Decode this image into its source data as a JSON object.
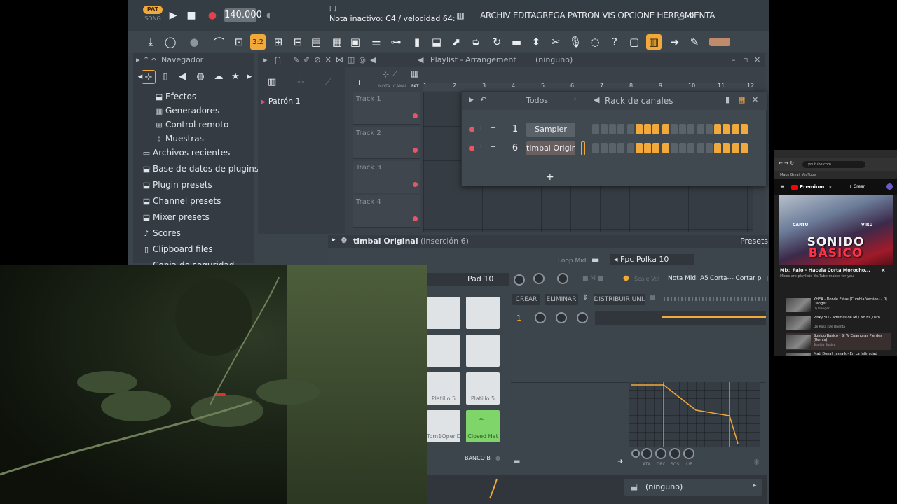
{
  "fl": {
    "pat_label": "PAT",
    "song_label": "SONG",
    "tempo": "140.000",
    "hint_top": "[ ]",
    "hint": "Nota inactivo: C4 / velocidad 64:",
    "menu": "ARCHIV EDITAGREGA PATRON  VIS OPCIONE HERRAMIENTA",
    "playlist_title": "Playlist - Arrangement",
    "playlist_pattern": "(ninguno)",
    "pattern_name": "Patrón 1",
    "ruler": [
      "1",
      "2",
      "3",
      "4",
      "5",
      "6",
      "7",
      "8",
      "9",
      "10",
      "11",
      "12"
    ],
    "tracks": [
      "Track 1",
      "Track 2",
      "Track 3",
      "Track 4"
    ],
    "head_labels": [
      "NOTA",
      "CANAL",
      "PAT"
    ]
  },
  "browser": {
    "title": "Navegador",
    "items": [
      {
        "icon": "plugin-icon",
        "label": "Efectos",
        "sub": true
      },
      {
        "icon": "piano-icon",
        "label": "Generadores",
        "sub": true
      },
      {
        "icon": "remote-icon",
        "label": "Control remoto",
        "sub": true
      },
      {
        "icon": "wave-icon",
        "label": "Muestras",
        "sub": true
      },
      {
        "icon": "folder-icon",
        "label": "Archivos recientes",
        "sub": false
      },
      {
        "icon": "plugin-db-icon",
        "label": "Base de datos de plugins",
        "sub": false
      },
      {
        "icon": "plugin-preset-icon",
        "label": "Plugin presets",
        "sub": false
      },
      {
        "icon": "channel-preset-icon",
        "label": "Channel presets",
        "sub": false
      },
      {
        "icon": "mixer-preset-icon",
        "label": "Mixer presets",
        "sub": false
      },
      {
        "icon": "note-icon",
        "label": "Scores",
        "sub": false
      },
      {
        "icon": "clipboard-icon",
        "label": "Clipboard files",
        "sub": false
      },
      {
        "icon": "backup-icon",
        "label": "Copia de seguridad",
        "sub": false
      }
    ]
  },
  "rack": {
    "filter": "Todos",
    "title": "Rack de canales",
    "channels": [
      {
        "num": "1",
        "name": "Sampler",
        "steps": [
          0,
          0,
          0,
          0,
          0,
          1,
          1,
          1,
          1,
          0,
          0,
          0,
          0,
          0,
          1,
          1,
          1,
          1
        ]
      },
      {
        "num": "6",
        "name": "timbal Original",
        "steps": [
          0,
          0,
          0,
          0,
          0,
          1,
          1,
          1,
          1,
          0,
          0,
          0,
          0,
          0,
          1,
          1,
          1,
          1
        ]
      }
    ],
    "add": "+"
  },
  "plugin": {
    "title": "timbal Original",
    "insert": "(Inserción 6)",
    "presets": "Presets",
    "loop_midi": "Loop Midi",
    "preset_name": "Fpc Polka 10",
    "pad_name": "Pad 10",
    "scale_vol": "Scale Vol",
    "nota_midi": "Nota Midi",
    "nota": "A5",
    "corta": "Corta",
    "cortar": "--- Cortar p",
    "crear": "CREAR",
    "eliminar": "ELIMINAR",
    "distribuir": "DISTRIBUIR UNI.",
    "layer_num": "1",
    "pads": [
      "",
      "",
      "",
      "",
      "Platillo 5",
      "Platillo 5",
      "Tom1OpenD",
      "Closed Hat"
    ],
    "banco": "BANCO B",
    "env_labels": [
      "ATA",
      "DEC",
      "SOS",
      "LIB"
    ],
    "bottom_selector": "(ninguno)"
  },
  "youtube": {
    "url": "youtube.com",
    "bookmarks": "Maps  Gmail  YouTube",
    "brand": "Premium",
    "create": "+ Crear",
    "thumb_title_1": "SONIDO",
    "thumb_title_2": "BÁSICO",
    "thumb_tag_left": "CARTU",
    "thumb_tag_right": "VIRU",
    "mix_title": "Mix: Palo - Hacela Corta Morocho...",
    "mix_sub": "Mixes are playlists YouTube makes for you",
    "items": [
      {
        "title": "KHEA - Donde Estas (Cumbia Version) - Dj Danger",
        "channel": "Dj Danger",
        "current": false
      },
      {
        "title": "Pinky SD - Además de Mí / No Es Justo",
        "channel": "De Rosa: De Buenta",
        "current": false
      },
      {
        "title": "Sonido Básico - Si Te Enamoras Pierdes (Remix)",
        "channel": "Sonido Basico",
        "current": true
      },
      {
        "title": "Mati Donal, Jamaik - En La Intimidad",
        "channel": "",
        "current": false
      }
    ]
  }
}
